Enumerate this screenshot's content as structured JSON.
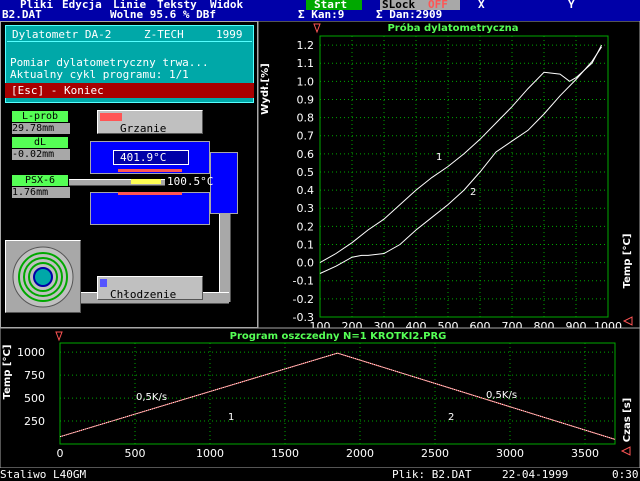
{
  "menu": {
    "items": [
      "Pliki",
      "Edycja",
      "Linie",
      "Teksty",
      "Widok"
    ],
    "start": "Start",
    "slock": "SLock",
    "off": "OFF",
    "x": "X",
    "y": "Y"
  },
  "status": {
    "file": "B2.DAT",
    "free": "Wolne  95.6 % DBf",
    "channels": "Σ Kan:9",
    "data": "Σ Dan:2909"
  },
  "device": {
    "name": "Dylatometr DA-2",
    "brand": "Z-TECH",
    "year": "1999",
    "line1": "Pomiar dylatometryczny trwa...",
    "line2": "Aktualny cykl programu: 1/1",
    "esc": "[Esc] - Koniec"
  },
  "readouts": {
    "lprob_label": "L-prob",
    "lprob_value": "29.78mm",
    "dl_label": "dL",
    "dl_value": "-0.02mm",
    "psx_label": "PSX-6",
    "psx_value": "1.76mm",
    "heating": "Grzanie",
    "heating_fraction": 0.22,
    "furnace_temp": "401.9°C",
    "sample_temp": "100.5°C",
    "cooling": "Chłodzenie",
    "cooling_fraction": 0.07
  },
  "top_chart": {
    "title": "Próba dylatometryczna",
    "ylabel": "Wydł.[%]",
    "xlabel": "Temp [°C]",
    "curve1_label": "1",
    "curve2_label": "2",
    "xticks": [
      "100",
      "200",
      "300",
      "400",
      "500",
      "600",
      "700",
      "800",
      "900",
      "1000"
    ],
    "yticks": [
      "1.2",
      "1.1",
      "1.0",
      "0.9",
      "0.8",
      "0.7",
      "0.6",
      "0.5",
      "0.4",
      "0.3",
      "0.2",
      "0.1",
      "0.0",
      "-0.1",
      "-0.2",
      "-0.3"
    ]
  },
  "bottom_chart": {
    "title": "Program oszczedny N=1 KROTKI2.PRG",
    "ylabel": "Temp [°C]",
    "xlabel": "Czas [s]",
    "rate1": "0,5K/s",
    "rate2": "0,5K/s",
    "seg1": "1",
    "seg2": "2",
    "xticks": [
      "0",
      "500",
      "1000",
      "1500",
      "2000",
      "2500",
      "3000",
      "3500"
    ],
    "yticks": [
      "1000",
      "750",
      "500",
      "250"
    ]
  },
  "chart_data": [
    {
      "type": "line",
      "title": "Próba dylatometryczna",
      "xlabel": "Temp [°C]",
      "ylabel": "Wydł.[%]",
      "xlim": [
        100,
        1000
      ],
      "ylim": [
        -0.3,
        1.25
      ],
      "grid": true,
      "series": [
        {
          "name": "1",
          "x": [
            100,
            150,
            200,
            250,
            300,
            350,
            400,
            450,
            500,
            550,
            600,
            650,
            700,
            750,
            800,
            850,
            880,
            900,
            950,
            980
          ],
          "y": [
            0.0,
            0.05,
            0.11,
            0.18,
            0.24,
            0.32,
            0.4,
            0.47,
            0.53,
            0.6,
            0.68,
            0.77,
            0.86,
            0.96,
            1.05,
            1.04,
            1.0,
            1.02,
            1.1,
            1.2
          ]
        },
        {
          "name": "2",
          "x": [
            100,
            150,
            200,
            230,
            250,
            300,
            350,
            400,
            450,
            500,
            550,
            600,
            650,
            700,
            750,
            800,
            850,
            900,
            950,
            980
          ],
          "y": [
            -0.06,
            -0.02,
            0.03,
            0.04,
            0.04,
            0.05,
            0.1,
            0.18,
            0.25,
            0.32,
            0.4,
            0.5,
            0.61,
            0.67,
            0.73,
            0.82,
            0.92,
            1.01,
            1.11,
            1.19
          ]
        }
      ]
    },
    {
      "type": "line",
      "title": "Program oszczedny N=1 KROTKI2.PRG",
      "xlabel": "Czas [s]",
      "ylabel": "Temp [°C]",
      "xlim": [
        0,
        3700
      ],
      "ylim": [
        0,
        1100
      ],
      "grid": true,
      "series": [
        {
          "name": "",
          "x": [
            0,
            1850,
            3700
          ],
          "y": [
            80,
            990,
            50
          ]
        }
      ]
    }
  ],
  "footer": {
    "steel": "Staliwo L40GM",
    "file": "Plik: B2.DAT",
    "date": "22-04-1999",
    "time": "0:30"
  },
  "colors": {
    "accent_blue": "#0000a8",
    "cyan": "#00a8a8",
    "red": "#a80000",
    "green_label": "#55ff55",
    "grid": "#00a800",
    "curve": "#ffffff",
    "program_line": "#ff5555"
  }
}
